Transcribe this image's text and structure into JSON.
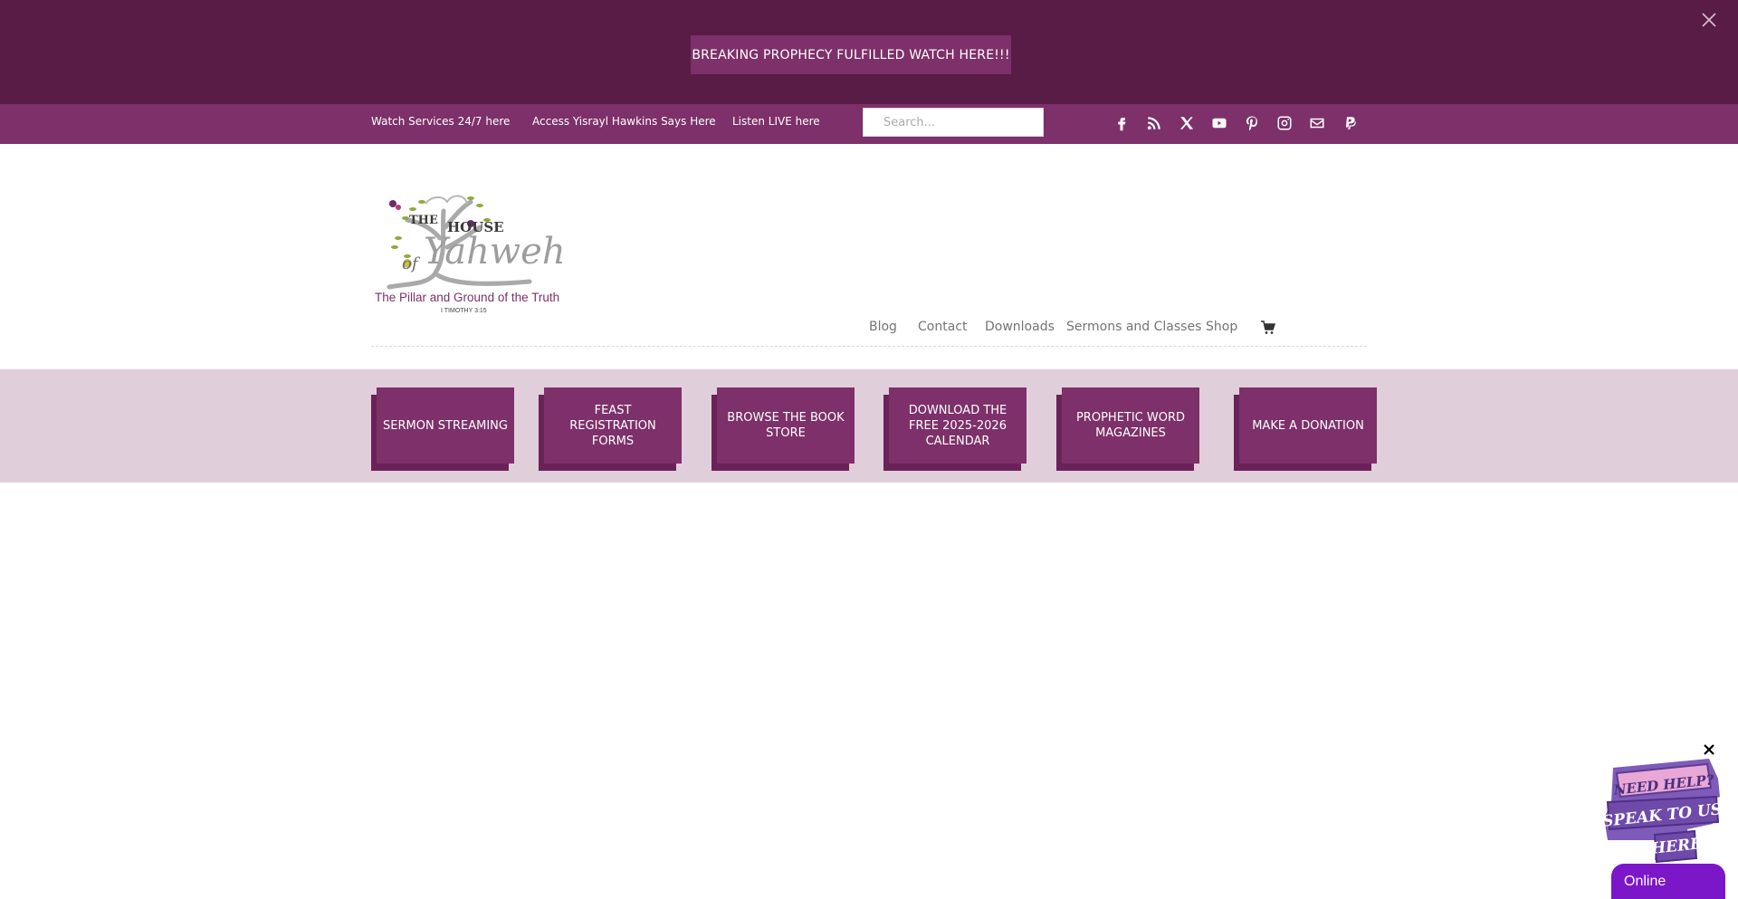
{
  "notice": {
    "button_label": "BREAKING PROPHECY FULFILLED WATCH HERE!!!"
  },
  "secondary_header": {
    "links": [
      "Watch Services 24/7 here",
      "Access Yisrayl Hawkins Says Here",
      "Listen LIVE here"
    ],
    "search_placeholder": "Search...",
    "social_icons": [
      "facebook-icon",
      "rss-icon",
      "x-icon",
      "youtube-icon",
      "pinterest-icon",
      "instagram-icon",
      "email-icon",
      "paypal-icon"
    ]
  },
  "logo": {
    "word_the": "THE",
    "word_house": "HOUSE",
    "word_of": "of",
    "word_yahweh": "Yahweh",
    "tagline": "The Pillar and Ground of the Truth",
    "verse": "I TIMOTHY 3:15"
  },
  "nav": {
    "items": [
      "Blog",
      "Contact",
      "Downloads",
      "Sermons and Classes",
      "Shop"
    ],
    "cart_icon": "cart-icon"
  },
  "cta_buttons": {
    "sermon": "SERMON STREAMING",
    "feast": "FEAST REGISTRATION FORMS",
    "book": "BROWSE THE BOOK STORE",
    "calendar": "DOWNLOAD THE FREE 2025-2026 CALENDAR",
    "magazines": "PROPHETIC WORD MAGAZINES",
    "donation": "MAKE A DONATION"
  },
  "chat": {
    "badge_line1": "NEED HELP?",
    "badge_line2": "SPEAK TO US",
    "badge_line3": "HERE",
    "status": "Online"
  },
  "colors": {
    "notice_bg": "#581c46",
    "brand_purple": "#7d3069",
    "band_bg": "#e1cedb",
    "chat_purple": "#7c16c9"
  }
}
